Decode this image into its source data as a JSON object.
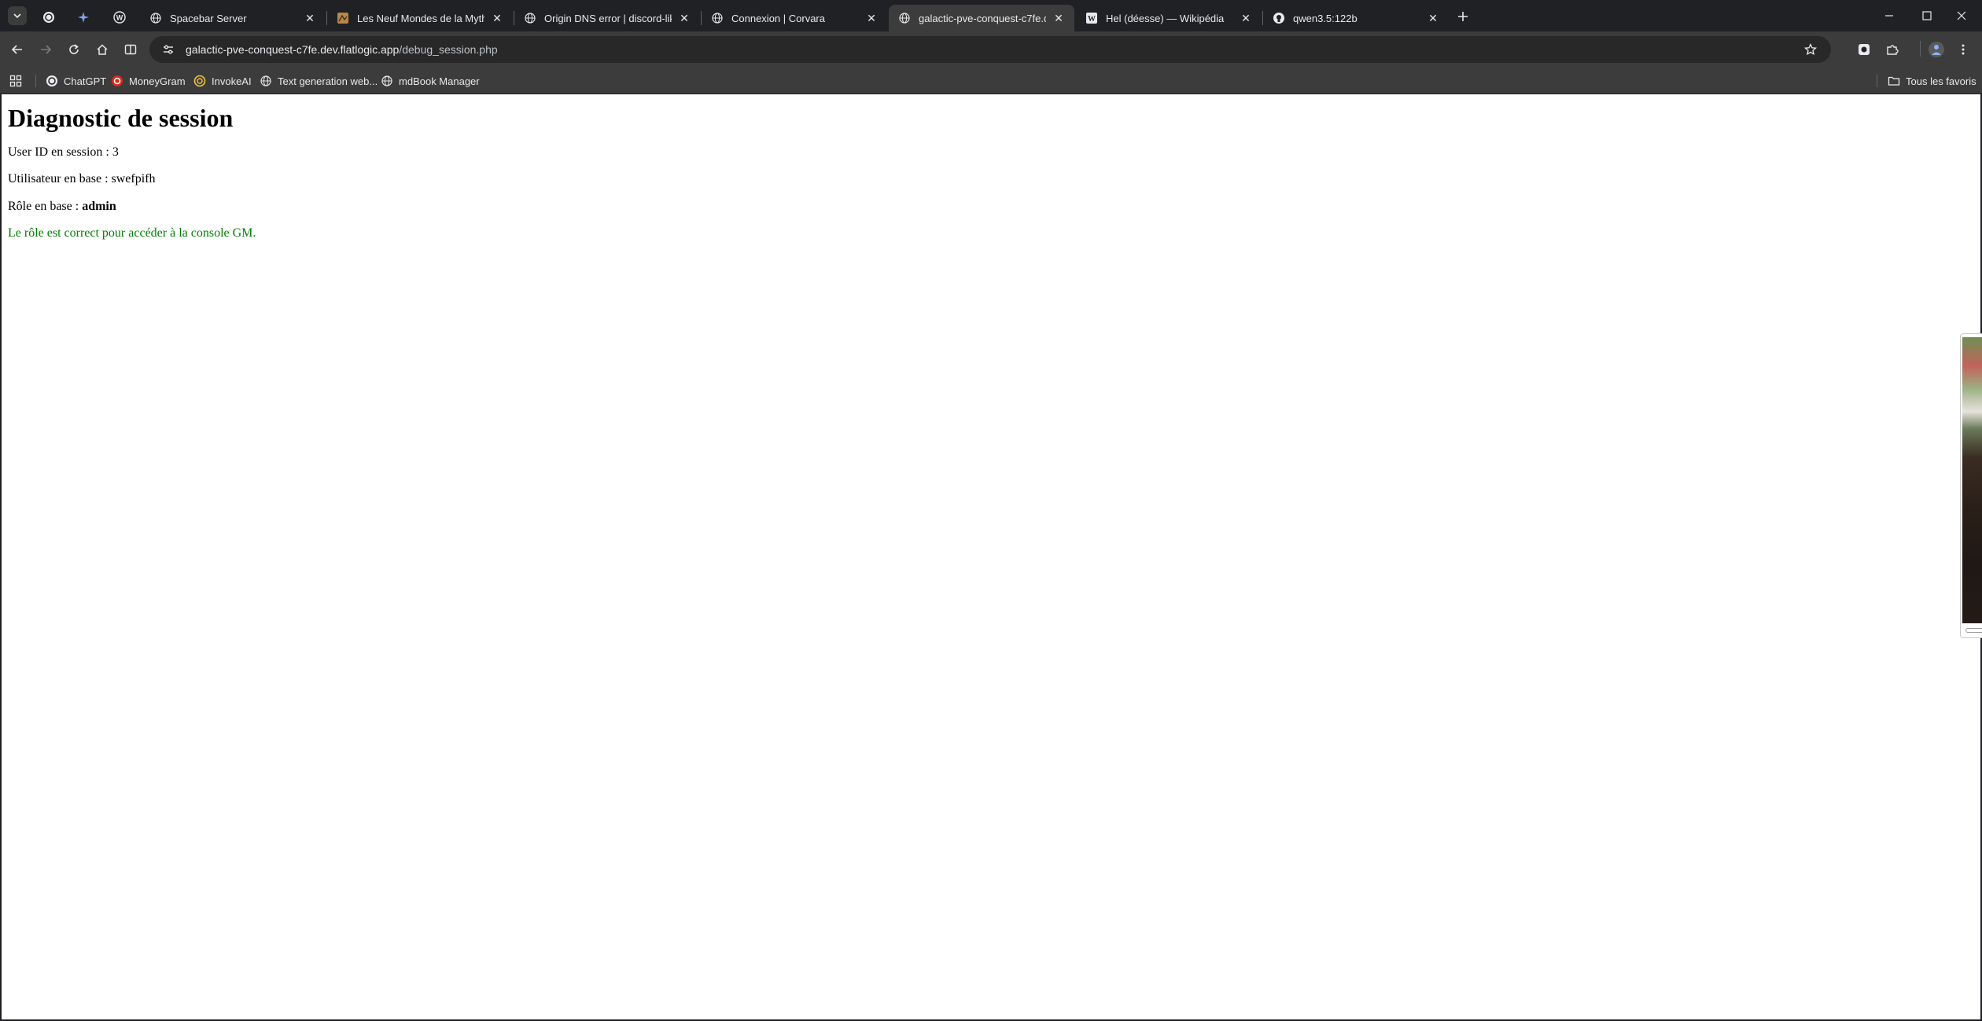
{
  "browser": {
    "tabs": [
      {
        "title": "Spacebar Server",
        "active": false
      },
      {
        "title": "Les Neuf Mondes de la Mytholo",
        "active": false
      },
      {
        "title": "Origin DNS error | discord-like-",
        "active": false
      },
      {
        "title": "Connexion | Corvara",
        "active": false
      },
      {
        "title": "galactic-pve-conquest-c7fe.dev",
        "active": true
      },
      {
        "title": "Hel (déesse) — Wikipédia",
        "active": false
      },
      {
        "title": "qwen3.5:122b",
        "active": false
      }
    ],
    "url_domain": "galactic-pve-conquest-c7fe.dev.flatlogic.app",
    "url_path": "/debug_session.php",
    "bookmarks": [
      {
        "label": "ChatGPT",
        "icon": "chatgpt-icon"
      },
      {
        "label": "MoneyGram",
        "icon": "moneygram-icon"
      },
      {
        "label": "InvokeAI",
        "icon": "invokeai-icon"
      },
      {
        "label": "Text generation web...",
        "icon": "globe-icon"
      },
      {
        "label": "mdBook Manager",
        "icon": "globe-icon"
      }
    ],
    "all_bookmarks_label": "Tous les favoris"
  },
  "page": {
    "heading": "Diagnostic de session",
    "user_id_label": "User ID en session : 3",
    "user_label": "Utilisateur en base : swefpifh",
    "role_label": "Rôle en base : ",
    "role_value": "admin",
    "status_message": "Le rôle est correct pour accéder à la console GM.",
    "status_color": "#008000"
  }
}
